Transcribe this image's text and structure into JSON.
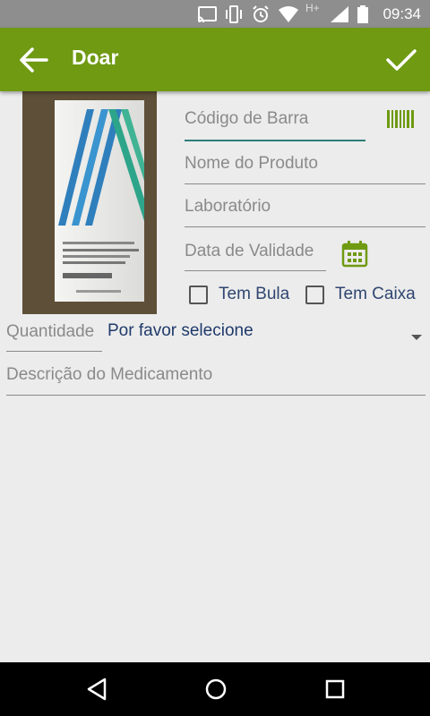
{
  "status_bar": {
    "network_label": "H+",
    "time": "09:34"
  },
  "app_bar": {
    "title": "Doar",
    "back_icon": "arrow-left-icon",
    "confirm_icon": "check-icon"
  },
  "form": {
    "barcode_label": "Código de Barra",
    "product_name_label": "Nome do Produto",
    "laboratory_label": "Laboratório",
    "expiry_label": "Data de Validade",
    "has_leaflet_label": "Tem Bula",
    "has_box_label": "Tem Caixa",
    "quantity_label": "Quantidade",
    "quantity_value": "Por favor selecione",
    "description_label": "Descrição do Medicamento"
  },
  "colors": {
    "app_bar": "#6f9a12",
    "accent_icon": "#6f9a12",
    "focus_line": "#2e7d78",
    "checkbox_label": "#2f4670",
    "quantity_value": "#1f3a6b"
  }
}
